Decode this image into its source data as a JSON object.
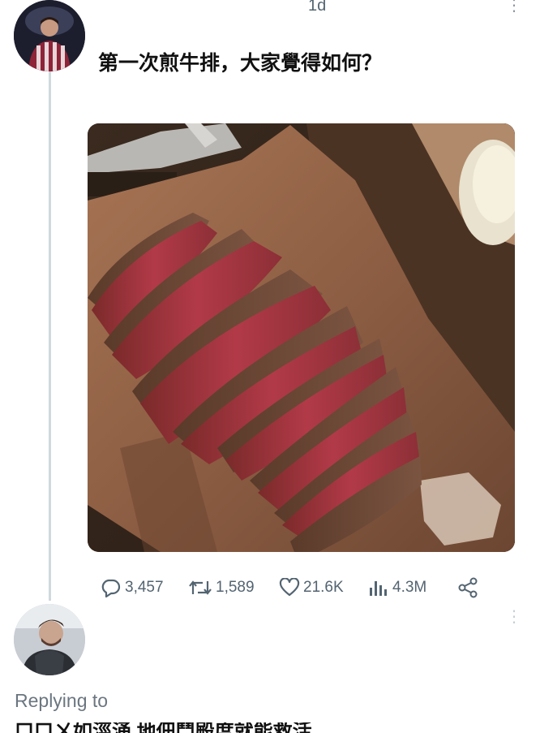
{
  "tweet": {
    "timestamp": "1d",
    "text": "第一次煎牛排，大家覺得如何？",
    "more_icon": "more-vertical-icon"
  },
  "actions": {
    "replies": "3,457",
    "retweets": "1,589",
    "likes": "21.6K",
    "views": "4.3M"
  },
  "reply": {
    "replying_to": "Replying to",
    "partial_text": "口口ㄨ如涇涌 地佃鬥殿度就能救活"
  },
  "colors": {
    "thread_line": "#cfd9de",
    "muted_text": "#536471",
    "steak_red": "#b23a48"
  }
}
